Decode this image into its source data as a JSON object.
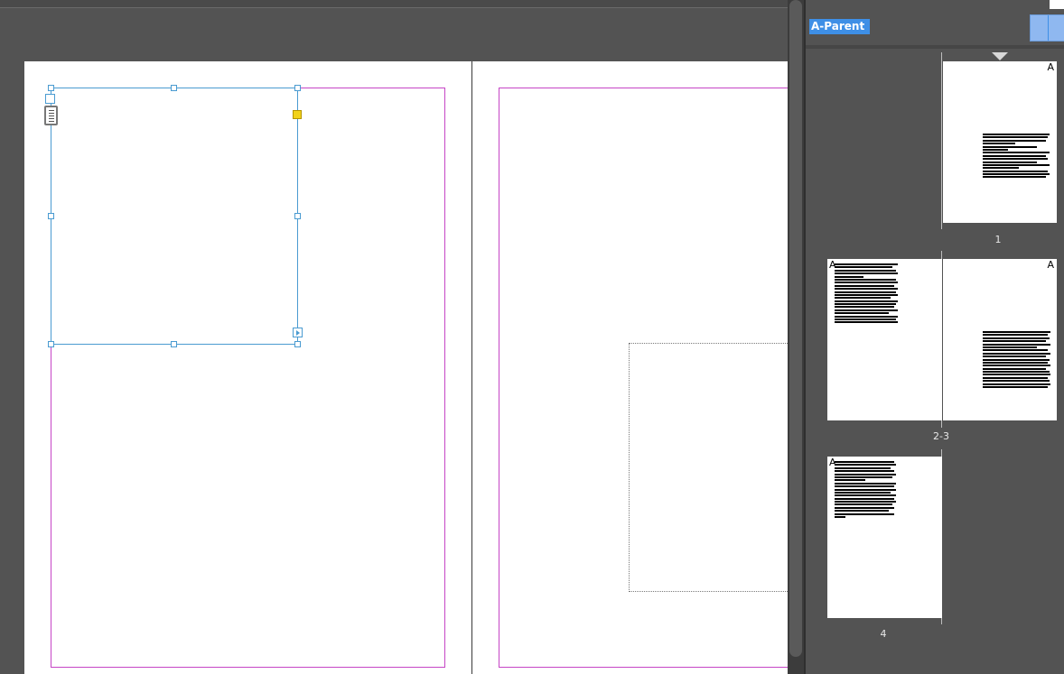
{
  "document": {
    "tool_indicators": {
      "text_frame": "selected-text-frame",
      "threading_icon": "text-thread-icon"
    }
  },
  "pages_panel": {
    "parent_spread_label": "A-Parent",
    "pages": [
      {
        "label": "1",
        "parent_prefix": "A"
      },
      {
        "label": "2-3",
        "left_parent_prefix": "A",
        "right_parent_prefix": "A"
      },
      {
        "label": "4",
        "parent_prefix": "A"
      }
    ]
  },
  "colors": {
    "selection": "#4a9bd1",
    "margin_guide": "#c645c6",
    "anchor_handle": "#f2d21a",
    "panel_highlight": "#3e8fe6"
  }
}
